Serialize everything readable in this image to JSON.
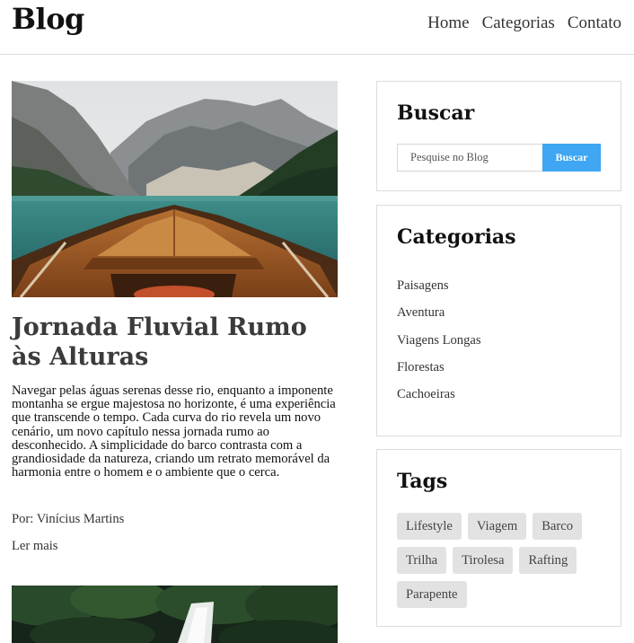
{
  "header": {
    "logo": "Blog",
    "nav": [
      "Home",
      "Categorias",
      "Contato"
    ]
  },
  "post": {
    "title": "Jornada Fluvial Rumo às Alturas",
    "body": "Navegar pelas águas serenas desse rio, enquanto a imponente montanha se ergue majestosa no horizonte, é uma experiência que transcende o tempo. Cada curva do rio revela um novo cenário, um novo capítulo nessa jornada rumo ao desconhecido. A simplicidade do barco contrasta com a grandiosidade da natureza, criando um retrato memorável da harmonia entre o homem e o ambiente que o cerca.",
    "author": "Por: Vinícius Martins",
    "read_more": "Ler mais"
  },
  "sidebar": {
    "search": {
      "title": "Buscar",
      "placeholder": "Pesquise no Blog",
      "button": "Buscar"
    },
    "categories": {
      "title": "Categorias",
      "items": [
        "Paisagens",
        "Aventura",
        "Viagens Longas",
        "Florestas",
        "Cachoeiras"
      ]
    },
    "tags": {
      "title": "Tags",
      "items": [
        "Lifestyle",
        "Viagem",
        "Barco",
        "Trilha",
        "Tirolesa",
        "Rafting",
        "Parapente"
      ]
    }
  },
  "colors": {
    "accent": "#3ea6f2",
    "tag_bg": "#e2e2e2",
    "border": "#dcdcdc"
  }
}
